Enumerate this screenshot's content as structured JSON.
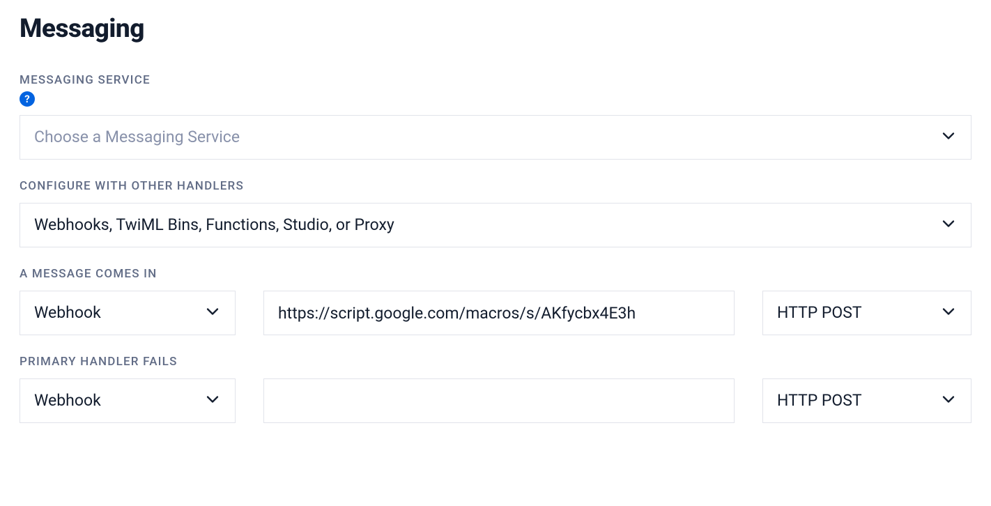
{
  "title": "Messaging",
  "messaging_service": {
    "label": "MESSAGING SERVICE",
    "placeholder": "Choose a Messaging Service",
    "help_char": "?"
  },
  "configure_handlers": {
    "label": "CONFIGURE WITH OTHER HANDLERS",
    "value": "Webhooks, TwiML Bins, Functions, Studio, or Proxy"
  },
  "message_in": {
    "label": "A MESSAGE COMES IN",
    "type": "Webhook",
    "url": "https://script.google.com/macros/s/AKfycbx4E3h",
    "method": "HTTP POST"
  },
  "primary_fail": {
    "label": "PRIMARY HANDLER FAILS",
    "type": "Webhook",
    "url": "",
    "method": "HTTP POST"
  }
}
